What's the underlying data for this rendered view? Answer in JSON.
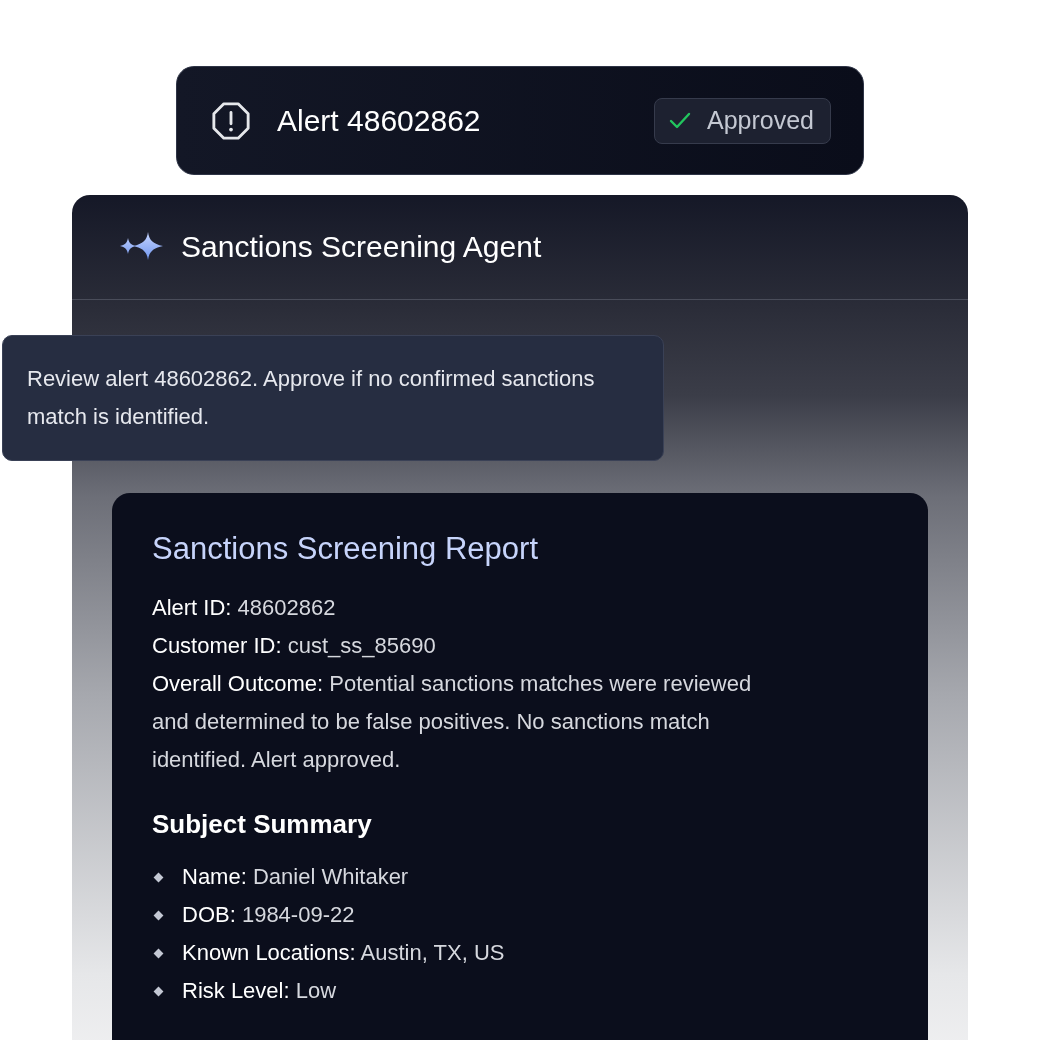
{
  "alert_bar": {
    "title": "Alert 48602862",
    "status": {
      "label": "Approved",
      "kind": "approved"
    }
  },
  "agent_panel": {
    "title": "Sanctions Screening Agent",
    "message": "Review alert 48602862. Approve if no confirmed sanctions match is identified.",
    "report": {
      "title": "Sanctions Screening Report",
      "fields": [
        "**Alert ID:** 48602862",
        "**Customer ID:** cust_ss_85690",
        "**Overall Outcome:** Potential sanctions matches were reviewed and determined to be false positives. No sanctions match identified. Alert approved."
      ],
      "sections": [
        {
          "heading": "Subject Summary",
          "items": [
            "**Name:** Daniel Whitaker",
            "**DOB:** 1984-09-22",
            "**Known Locations:** Austin, TX, US",
            "**Risk Level:** Low"
          ]
        }
      ]
    }
  }
}
